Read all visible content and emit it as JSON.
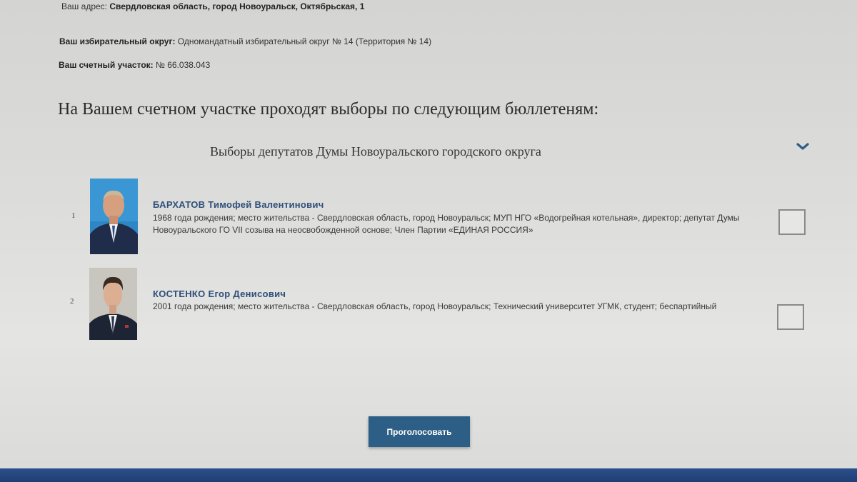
{
  "info": {
    "address_label": "Ваш адрес:",
    "address_value": "Свердловская область, город Новоуральск, Октябрьская, 1",
    "okrug_label": "Ваш избирательный округ:",
    "okrug_value": "Одномандатный избирательный округ № 14 (Территория № 14)",
    "uchastok_label": "Ваш счетный участок:",
    "uchastok_value": "№ 66.038.043"
  },
  "heading": "На Вашем счетном участке проходят выборы по следующим бюллетеням:",
  "ballot": {
    "title": "Выборы депутатов Думы Новоуральского городского округа",
    "candidates": [
      {
        "number": "1",
        "name": "БАРХАТОВ Тимофей Валентинович",
        "description": "1968 года рождения; место жительства - Свердловская область, город Новоуральск; МУП НГО «Водогрейная котельная», директор; депутат Думы Новоуральского ГО VII созыва на неосвобожденной основе; Член Партии «ЕДИНАЯ РОССИЯ»"
      },
      {
        "number": "2",
        "name": "КОСТЕНКО Егор Денисович",
        "description": "2001 года рождения; место жительства - Свердловская область, город Новоуральск; Технический университет УГМК, студент; беспартийный"
      }
    ]
  },
  "vote_button": "Проголосовать",
  "colors": {
    "accent": "#2d5f86",
    "candidate_name": "#2e4f7a",
    "bottom_bar": "#2a4f8a"
  }
}
